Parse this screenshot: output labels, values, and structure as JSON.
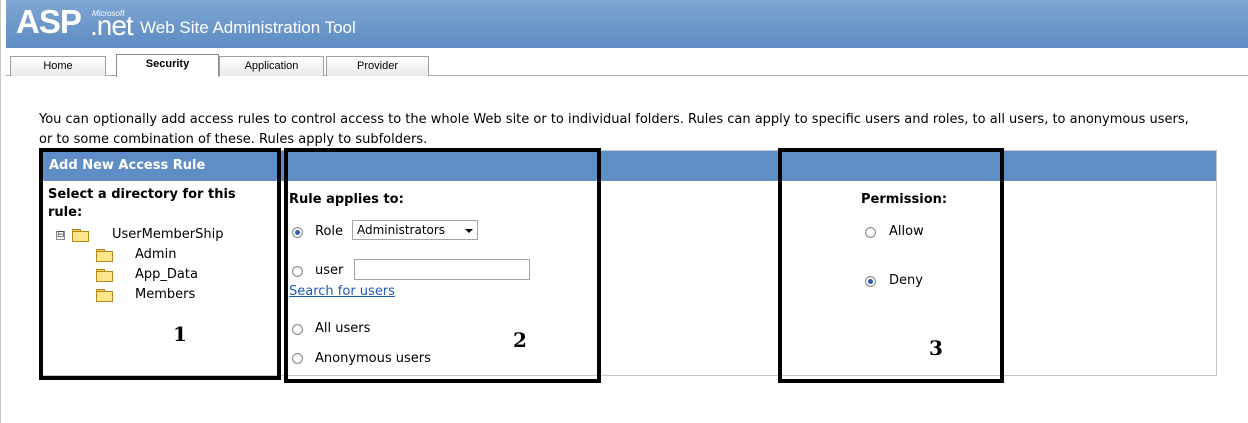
{
  "header": {
    "logo_main": "ASP",
    "logo_small": "Microsoft",
    "logo_net": ".net",
    "title": "Web Site Administration Tool"
  },
  "tabs": [
    {
      "label": "Home",
      "active": false
    },
    {
      "label": "Security",
      "active": true
    },
    {
      "label": "Application",
      "active": false
    },
    {
      "label": "Provider",
      "active": false
    }
  ],
  "intro_text": "You can optionally add access rules to control access to the whole Web site or to individual folders. Rules can apply to specific users and roles, to all users, to anonymous users, or to some combination of these. Rules apply to subfolders.",
  "panel": {
    "title": "Add New Access Rule",
    "directory_label": "Select a directory for this rule:",
    "tree": {
      "root": "UserMemberShip",
      "expander": "⊟",
      "children": [
        "Admin",
        "App_Data",
        "Members"
      ]
    },
    "rule": {
      "label": "Rule applies to:",
      "role_option": "Role",
      "role_selected": "Administrators",
      "user_option": "user",
      "user_value": "",
      "search_link": "Search for users",
      "all_users": "All users",
      "anonymous_users": "Anonymous users",
      "selected": "role"
    },
    "permission": {
      "label": "Permission:",
      "allow": "Allow",
      "deny": "Deny",
      "selected": "deny"
    }
  },
  "annotations": [
    "1",
    "2",
    "3"
  ]
}
